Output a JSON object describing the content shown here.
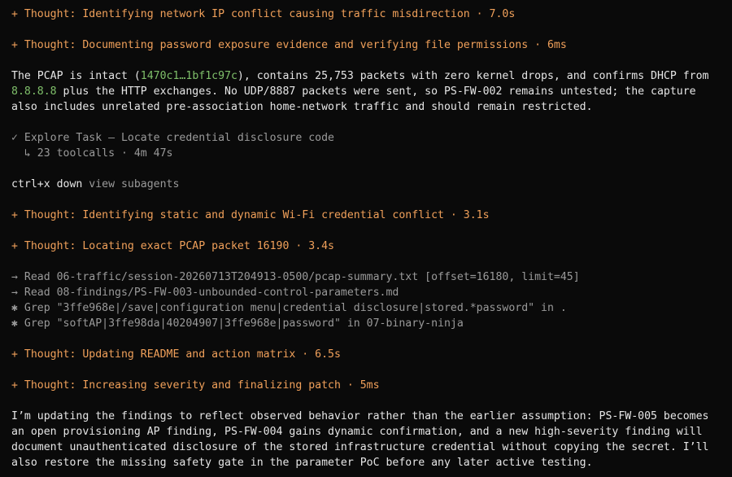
{
  "thoughts": [
    "+ Thought: Identifying network IP conflict causing traffic misdirection · 7.0s",
    "+ Thought: Documenting password exposure evidence and verifying file permissions · 6ms",
    "+ Thought: Identifying static and dynamic Wi-Fi credential conflict · 3.1s",
    "+ Thought: Locating exact PCAP packet 16190 · 3.4s",
    "+ Thought: Updating README and action matrix · 6.5s",
    "+ Thought: Increasing severity and finalizing patch · 5ms"
  ],
  "para1": {
    "l1_a": "The PCAP is intact (",
    "l1_hash": "1470c1…1bf1c97c",
    "l1_b": "), contains 25,753 packets with zero kernel drops, and confirms DHCP from",
    "l2_ip": "8.8.8.8",
    "l2_b": " plus the HTTP exchanges. No UDP/8887 packets were sent, so PS-FW-002 remains untested; the capture",
    "l3": "also includes unrelated pre-association home-network traffic and should remain restricted."
  },
  "task": {
    "title": "✓ Explore Task — Locate credential disclosure code",
    "sub": "  ↳ 23 toolcalls · 4m 47s"
  },
  "hint": {
    "keys": "ctrl+x down",
    "label": " view subagents"
  },
  "tool_lines": [
    "→ Read 06-traffic/session-20260713T204913-0500/pcap-summary.txt [offset=16180, limit=45]",
    "→ Read 08-findings/PS-FW-003-unbounded-control-parameters.md",
    "✱ Grep \"3ffe968e|/save|configuration menu|credential disclosure|stored.*password\" in .",
    "✱ Grep \"softAP|3ffe98da|40204907|3ffe968e|password\" in 07-binary-ninja"
  ],
  "para2": [
    "I’m updating the findings to reflect observed behavior rather than the earlier assumption: PS-FW-005 becomes",
    "an open provisioning AP finding, PS-FW-004 gains dynamic confirmation, and a new high-severity finding will",
    "document unauthenticated disclosure of the stored infrastructure credential without copying the secret. I’ll",
    "also restore the missing safety gate in the parameter PoC before any later active testing."
  ],
  "colors": {
    "background": "#0a0a0a",
    "text": "#e6e6e6",
    "thought": "#f0a05a",
    "dim": "#9a9a9a",
    "accent_green": "#7fbf6a"
  }
}
